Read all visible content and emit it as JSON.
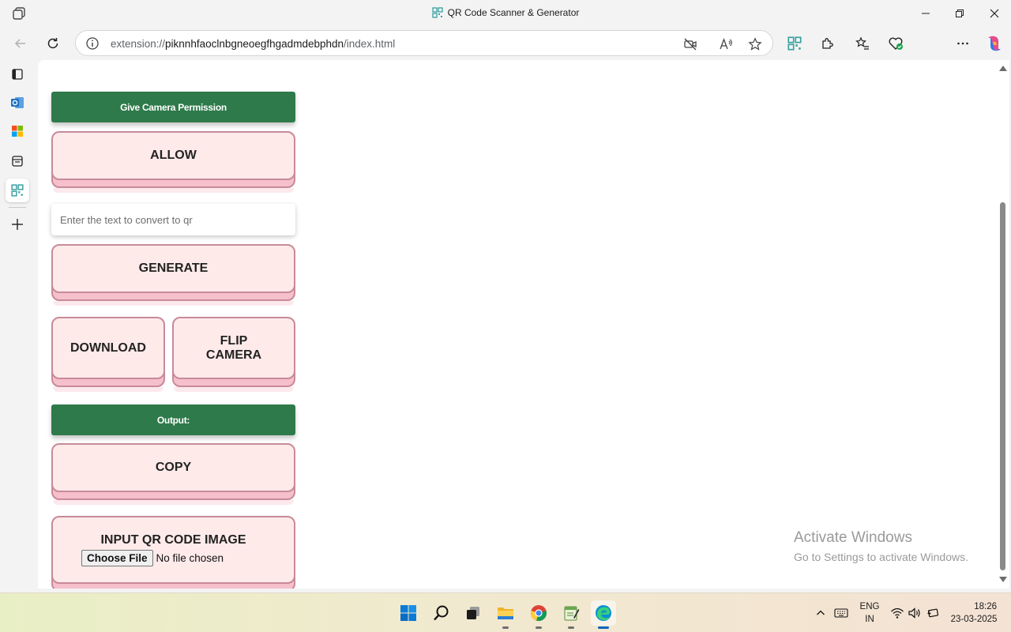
{
  "window": {
    "title": "QR Code Scanner & Generator"
  },
  "browser": {
    "url_scheme": "extension://",
    "url_host": "piknnhfaoclnbgneoegfhgadmdebphdn",
    "url_path": "/index.html"
  },
  "page": {
    "camera_header": "Give Camera Permission",
    "allow_label": "ALLOW",
    "text_input_placeholder": "Enter the text to convert to qr",
    "text_input_value": "",
    "generate_label": "GENERATE",
    "download_label": "DOWNLOAD",
    "flip_camera_line1": "FLIP",
    "flip_camera_line2": "CAMERA",
    "output_header": "Output:",
    "copy_label": "COPY",
    "input_qr_label": "INPUT QR CODE IMAGE",
    "choose_file_label": "Choose File",
    "file_status": "No file chosen"
  },
  "watermark": {
    "line1": "Activate Windows",
    "line2": "Go to Settings to activate Windows."
  },
  "taskbar": {
    "lang_line1": "ENG",
    "lang_line2": "IN",
    "time": "18:26",
    "date": "23-03-2025"
  },
  "colors": {
    "accent_green": "#2e7a4a",
    "button_pink": "#ffeaea",
    "button_border": "#c88a98",
    "edge_blue": "#0067c0"
  }
}
